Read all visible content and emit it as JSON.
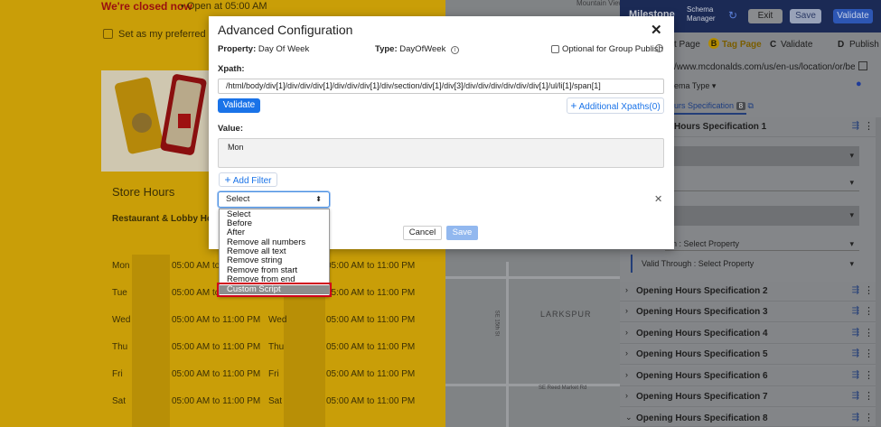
{
  "background": {
    "closed_text": "We're closed now",
    "open_text": "• Open at 05:00 AM",
    "preferred_text": "Set as my preferred loc",
    "store_hours_title": "Store Hours",
    "restaurant_heading": "Restaurant & Lobby Ho",
    "schedule_left": [
      {
        "day": "Mon",
        "hours": "05:00 AM to 11:00 PM"
      },
      {
        "day": "Tue",
        "hours": "05:00 AM to 11:00 PM"
      },
      {
        "day": "Wed",
        "hours": "05:00 AM to 11:00 PM"
      },
      {
        "day": "Thu",
        "hours": "05:00 AM to 11:00 PM"
      },
      {
        "day": "Fri",
        "hours": "05:00 AM to 11:00 PM"
      },
      {
        "day": "Sat",
        "hours": "05:00 AM to 11:00 PM"
      }
    ],
    "schedule_right": [
      {
        "day": "",
        "hours": "05:00 AM to 11:00 PM"
      },
      {
        "day": "",
        "hours": "05:00 AM to 11:00 PM"
      },
      {
        "day": "Wed",
        "hours": "05:00 AM to 11:00 PM"
      },
      {
        "day": "Thu",
        "hours": "05:00 AM to 11:00 PM"
      },
      {
        "day": "Fri",
        "hours": "05:00 AM to 11:00 PM"
      },
      {
        "day": "Sat",
        "hours": "05:00 AM to 11:00 PM"
      }
    ],
    "map_labels": {
      "school": "Mountain View High School",
      "larkspur": "LARKSPUR",
      "street1": "SE 15th St",
      "street2": "SE Reed Market Rd"
    }
  },
  "panel": {
    "brand": "Milestone",
    "brand_sub1": "Schema",
    "brand_sub2": "Manager",
    "exit_label": "Exit",
    "save_label": "Save",
    "validate_label": "Validate",
    "tabs": [
      {
        "badge": "",
        "label": "t Page"
      },
      {
        "badge": "B",
        "label": "Tag Page"
      },
      {
        "badge": "C",
        "label": "Validate"
      },
      {
        "badge": "D",
        "label": "Publish"
      }
    ],
    "url": "/www.mcdonalds.com/us/en-us/location/or/bend/2...",
    "schema_type_label": "ema Type",
    "hours_spec_tab": "urs Specification",
    "hours_spec_count": "8",
    "first_spec": "Hours Specification 1",
    "field_k": "k",
    "valid_from": "n : Select Property",
    "valid_through": "Valid Through : Select Property",
    "specs": [
      "Opening Hours Specification 2",
      "Opening Hours Specification 3",
      "Opening Hours Specification 4",
      "Opening Hours Specification 5",
      "Opening Hours Specification 6",
      "Opening Hours Specification 7",
      "Opening Hours Specification 8"
    ]
  },
  "modal": {
    "title": "Advanced Configuration",
    "property_label": "Property:",
    "property_value": "Day Of Week",
    "type_label": "Type:",
    "type_value": "DayOfWeek",
    "group_publish_label": "Optional for Group Publish",
    "group_publish_checked": false,
    "xpath_label": "Xpath:",
    "xpath_value": "/html/body/div[1]/div/div/div[1]/div/div/div[1]/div/section/div[1]/div[3]/div/div/div/div/div/div[1]/ul/li[1]/span[1]",
    "validate_label": "Validate",
    "additional_xpaths_label": "Additional Xpaths(0)",
    "value_label": "Value:",
    "value_text": "Mon",
    "add_filter_label": "Add Filter",
    "select_value": "Select",
    "cancel_label": "Cancel",
    "save_label": "Save",
    "dropdown_options": [
      "Select",
      "Before",
      "After",
      "Remove all numbers",
      "Remove all text",
      "Remove string",
      "Remove from start",
      "Remove from end",
      "Custom Script"
    ],
    "highlighted_option": "Custom Script",
    "highlight_color": "#d0021b"
  }
}
